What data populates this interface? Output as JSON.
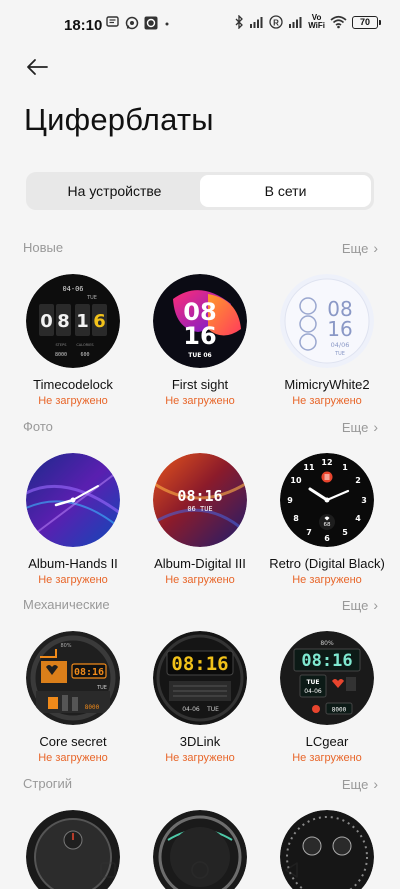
{
  "status_bar": {
    "time": "18:10",
    "vowifi": [
      "Vo",
      "WiFi"
    ],
    "battery": "70"
  },
  "header": {
    "title": "Циферблаты"
  },
  "tabs": [
    {
      "label": "На устройстве",
      "active": false
    },
    {
      "label": "В сети",
      "active": true
    }
  ],
  "sections": [
    {
      "title": "Новые",
      "more": "Еще",
      "items": [
        {
          "name": "Timecodelock",
          "status": "Не загружено"
        },
        {
          "name": "First sight",
          "status": "Не загружено"
        },
        {
          "name": "MimicryWhite2",
          "status": "Не загружено"
        }
      ]
    },
    {
      "title": "Фото",
      "more": "Еще",
      "items": [
        {
          "name": "Album-Hands II",
          "status": "Не загружено"
        },
        {
          "name": "Album-Digital III",
          "status": "Не загружено"
        },
        {
          "name": "Retro (Digital Black)",
          "status": "Не загружено"
        }
      ]
    },
    {
      "title": "Механические",
      "more": "Еще",
      "items": [
        {
          "name": "Core secret",
          "status": "Не загружено"
        },
        {
          "name": "3DLink",
          "status": "Не загружено"
        },
        {
          "name": "LCgear",
          "status": "Не загружено"
        }
      ]
    },
    {
      "title": "Строгий",
      "more": "Еще"
    }
  ],
  "face_text": {
    "timecodelock": {
      "date": "04-06",
      "day": "TUE",
      "digits": [
        "0",
        "8",
        "1",
        "6"
      ],
      "labels": [
        "STEPS",
        "CALORIES"
      ],
      "values": [
        "8000",
        "600"
      ]
    },
    "first_sight": {
      "hour": "08",
      "minute": "16",
      "day": "TUE 06"
    },
    "mimicry": {
      "hour": "08",
      "minute": "16",
      "date": "04/06",
      "day": "TUE"
    },
    "album_digital": {
      "time": "08:16",
      "date": "06 TUE"
    },
    "retro": {
      "heart": "68"
    },
    "core_secret": {
      "time": "08:16",
      "day": "TUE",
      "steps": "8000",
      "battery": "80%"
    },
    "link3d": {
      "time": "08:16",
      "date": "04-06",
      "day": "TUE"
    },
    "lcgear": {
      "time": "08:16",
      "battery": "80%",
      "day": "TUE",
      "date": "04-06",
      "steps": "8000"
    }
  },
  "colors": {
    "accent_status": "#e8662a",
    "bg": "#f5f5f5"
  }
}
